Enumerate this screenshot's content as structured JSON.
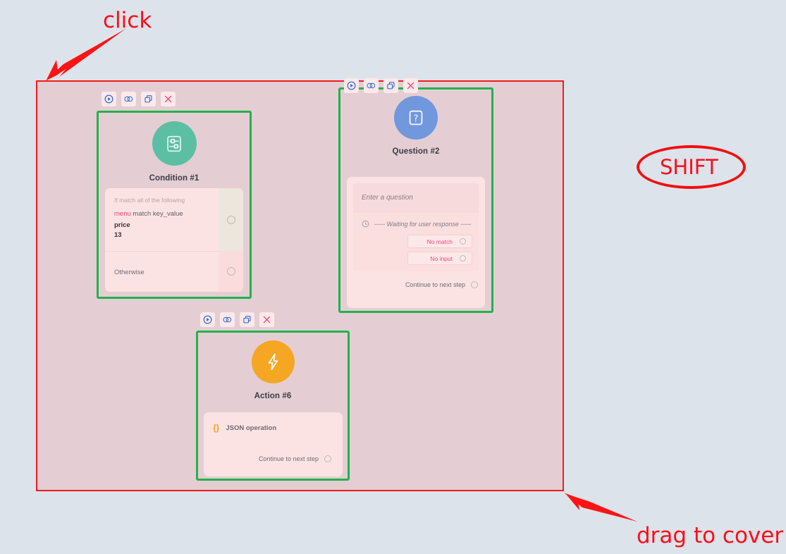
{
  "page": {
    "background_color": "#dde3ea",
    "selection_fill": "#e4ced3",
    "selection_border_color": "#ef1d1d",
    "node_border_color": "#22b24c"
  },
  "annotations": [
    {
      "id": "click",
      "text": "click",
      "color": "#fc0d1b",
      "kind": "arrow-label"
    },
    {
      "id": "shift",
      "text": "SHIFT",
      "color": "#f01010",
      "kind": "circled-label"
    },
    {
      "id": "drag",
      "text": "drag to cover",
      "color": "#fc0d1b",
      "kind": "arrow-label"
    }
  ],
  "toolbar": {
    "buttons": [
      {
        "name": "run-icon",
        "label": "Run"
      },
      {
        "name": "link-icon",
        "label": "Link"
      },
      {
        "name": "duplicate-icon",
        "label": "Duplicate"
      },
      {
        "name": "delete-icon",
        "label": "Delete"
      }
    ]
  },
  "nodes": {
    "condition": {
      "title": "Condition #1",
      "icon": "sliders-icon",
      "avatar_color": "#5cbfa3",
      "match_label": "If match all of the following",
      "expr_key": "menu",
      "expr_rest": "match key_value",
      "field": "price",
      "value": "13",
      "otherwise_label": "Otherwise"
    },
    "question": {
      "title": "Question #2",
      "icon": "question-mark-icon",
      "avatar_color": "#7197dd",
      "prompt_placeholder": "Enter a question",
      "waiting_text": "----- Waiting for user response -----",
      "choices": [
        {
          "label": "No match"
        },
        {
          "label": "No input"
        }
      ],
      "continue_label": "Continue to next step"
    },
    "action": {
      "title": "Action #6",
      "icon": "lightning-bolt-icon",
      "avatar_color": "#f5a623",
      "operation_label": "JSON operation",
      "operation_icon": "curly-braces-icon",
      "continue_label": "Continue to next step"
    }
  }
}
